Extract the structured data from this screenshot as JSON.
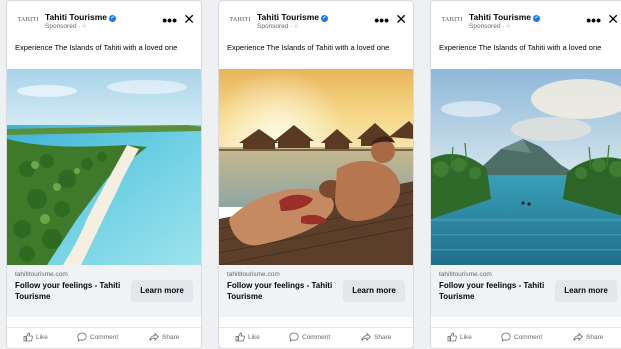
{
  "ads": [
    {
      "page_name": "Tahiti Tourisme",
      "logo_text": "TAHITI",
      "sponsored": "Sponsored · ○",
      "caption": "Experience The Islands of Tahiti with a loved one",
      "domain": "tahititourisme.com",
      "headline": "Follow your feelings - Tahiti Tourisme",
      "cta_label": "Learn more",
      "actions": {
        "like": "Like",
        "comment": "Comment",
        "share": "Share"
      }
    },
    {
      "page_name": "Tahiti Tourisme",
      "logo_text": "TAHITI",
      "sponsored": "Sponsored · ○",
      "caption": "Experience The Islands of Tahiti with a loved one",
      "domain": "tahititourisme.com",
      "headline": "Follow your feelings - Tahiti Tourisme",
      "cta_label": "Learn more",
      "actions": {
        "like": "Like",
        "comment": "Comment",
        "share": "Share"
      }
    },
    {
      "page_name": "Tahiti Tourisme",
      "logo_text": "TAHITI",
      "sponsored": "Sponsored · ○",
      "caption": "Experience The Islands of Tahiti with a loved one",
      "domain": "tahititourisme.com",
      "headline": "Follow your feelings - Tahiti Tourisme",
      "cta_label": "Learn more",
      "actions": {
        "like": "Like",
        "comment": "Comment",
        "share": "Share"
      }
    }
  ],
  "icons": {
    "more": "more-options-icon",
    "close": "close-icon",
    "verified": "verified-badge-icon",
    "like": "thumbs-up-icon",
    "comment": "comment-bubble-icon",
    "share": "share-arrow-icon"
  },
  "colors": {
    "verified": "#1877f2",
    "footer_bg": "#f0f2f5",
    "cta_bg": "#e4e6eb",
    "secondary_text": "#65676b"
  }
}
